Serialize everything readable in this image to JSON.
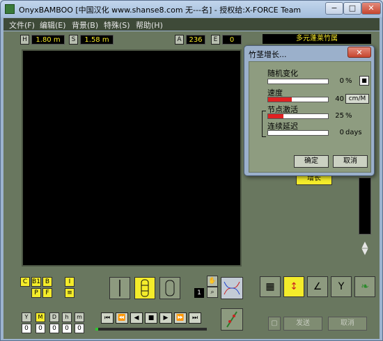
{
  "window": {
    "title": "OnyxBAMBOO [中国汉化 www.shanse8.com 无---名] - 授权给:X-FORCE Team",
    "min_glyph": "−",
    "max_glyph": "□",
    "close_glyph": "✕"
  },
  "menu": [
    "文件(F)",
    "编辑(E)",
    "背景(B)",
    "特殊(S)",
    "帮助(H)"
  ],
  "viewer_header": {
    "h_label": "H",
    "h_value": "1.80 m",
    "s_label": "S",
    "s_value": "1.58 m",
    "a_label": "A",
    "a_value": "236",
    "e_label": "E",
    "e_value": "0"
  },
  "left_tools": {
    "c": "C",
    "b1": "B1",
    "b_mark": "B",
    "p": "P",
    "f": "F",
    "i": "I",
    "counter": "1"
  },
  "time_units": [
    {
      "label": "Y",
      "value": "0",
      "selected": false
    },
    {
      "label": "M",
      "value": "0",
      "selected": true
    },
    {
      "label": "D",
      "value": "0",
      "selected": false
    },
    {
      "label": "h",
      "value": "0",
      "selected": false
    },
    {
      "label": "m",
      "value": "0",
      "selected": false
    }
  ],
  "transport": [
    "⏮",
    "⏪",
    "◀",
    "■",
    "▶",
    "⏩",
    "⏭"
  ],
  "right_panel": {
    "bamboo_name": "多元蓬莱竹属",
    "grow_label": "增长",
    "send_label": "发送",
    "cancel_label": "取消"
  },
  "dialog": {
    "title": "竹茎增长...",
    "close_glyph": "✕",
    "params": [
      {
        "label": "随机变化",
        "value": "0",
        "unit": "%",
        "fill": 0
      },
      {
        "label": "速度",
        "value": "40",
        "unit": "cm/M",
        "fill": 0.4
      },
      {
        "label": "节点激活",
        "value": "25",
        "unit": "%",
        "fill": 0.25
      },
      {
        "label": "连续延迟",
        "value": "0",
        "unit": "days",
        "fill": 0
      }
    ],
    "ok_label": "确定",
    "cancel_label": "取消"
  },
  "colors": {
    "panel": "#69775f",
    "accent_yellow": "#f4ec2a",
    "bar_red": "#e02222"
  }
}
